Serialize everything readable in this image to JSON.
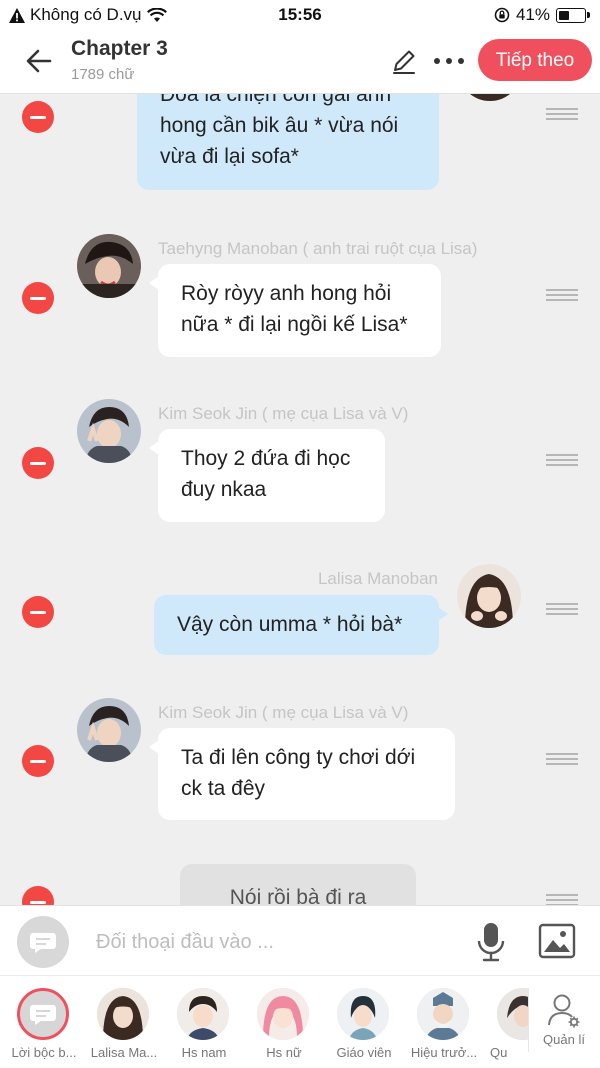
{
  "status_bar": {
    "carrier": "Không có D.vụ",
    "time": "15:56",
    "battery_percent": "41%",
    "battery_level": 0.41
  },
  "header": {
    "title": "Chapter 3",
    "word_count": "1789 chữ",
    "next_label": "Tiếp theo"
  },
  "messages": [
    {
      "speaker": "",
      "text_lines": [
        "Đoá là chiện con gái anh",
        "hong cần bik âu * vừa nói",
        "vừa đi lại sofa*"
      ],
      "side": "right",
      "avatar": "lisa-avatar"
    },
    {
      "speaker": "Taehyng Manoban ( anh trai ruột cụa Lisa)",
      "text_lines": [
        "Ròy ròyy anh hong hỏi",
        "nữa * đi lại ngồi kế Lisa*"
      ],
      "side": "left",
      "avatar": "taehyung-avatar"
    },
    {
      "speaker": "Kim Seok Jin ( mẹ cụa Lisa và V)",
      "text_lines": [
        "Thoy 2 đứa đi học",
        "đuy nkaa"
      ],
      "side": "left",
      "avatar": "seokjin-avatar"
    },
    {
      "speaker": "Lalisa Manoban",
      "text_lines": [
        "Vậy còn umma * hỏi bà*"
      ],
      "side": "right",
      "avatar": "lisa-avatar"
    },
    {
      "speaker": "Kim Seok Jin ( mẹ cụa Lisa và V)",
      "text_lines": [
        "Ta đi lên công ty chơi dới",
        "ck ta đêy"
      ],
      "side": "left",
      "avatar": "seokjin-avatar"
    },
    {
      "speaker": "",
      "text_lines": [
        "Nói rồi bà đi ra ngoài"
      ],
      "side": "narration",
      "avatar": ""
    }
  ],
  "input": {
    "placeholder": "Đối thoại đầu vào ..."
  },
  "characters": [
    {
      "label": "Lời bộc b...",
      "icon": "narration-icon",
      "selected": true
    },
    {
      "label": "Lalisa Ma...",
      "icon": "lisa-avatar",
      "selected": false
    },
    {
      "label": "Hs nam",
      "icon": "male-student-avatar",
      "selected": false
    },
    {
      "label": "Hs nữ",
      "icon": "female-student-avatar",
      "selected": false
    },
    {
      "label": "Giáo viên",
      "icon": "teacher-avatar",
      "selected": false
    },
    {
      "label": "Hiệu trưở...",
      "icon": "principal-avatar",
      "selected": false
    },
    {
      "label": "Qu",
      "icon": "partial-avatar",
      "selected": false
    }
  ],
  "manage_label": "Quản lí",
  "colors": {
    "accent": "#f0505e",
    "delete": "#f24743",
    "bubble_right": "#cfe9fb",
    "bubble_left": "#ffffff",
    "background": "#efefef"
  }
}
